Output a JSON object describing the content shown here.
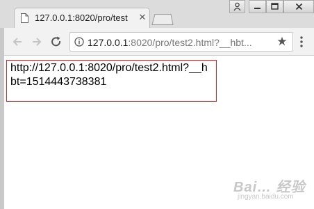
{
  "tab": {
    "title": "127.0.0.1:8020/pro/test",
    "close_glyph": "✕"
  },
  "address_bar": {
    "url_host": "127.0.0.1",
    "url_rest": ":8020/pro/test2.html?__hbt..."
  },
  "page": {
    "text": "http://127.0.0.1:8020/pro/test2.html?__hbt=1514443738381",
    "border_color": "#e02020"
  },
  "watermark": {
    "logo": "Bai… 经验",
    "url": "jingyan.baidu.com"
  },
  "icons": {
    "page_icon": "document-icon",
    "star": "★"
  }
}
